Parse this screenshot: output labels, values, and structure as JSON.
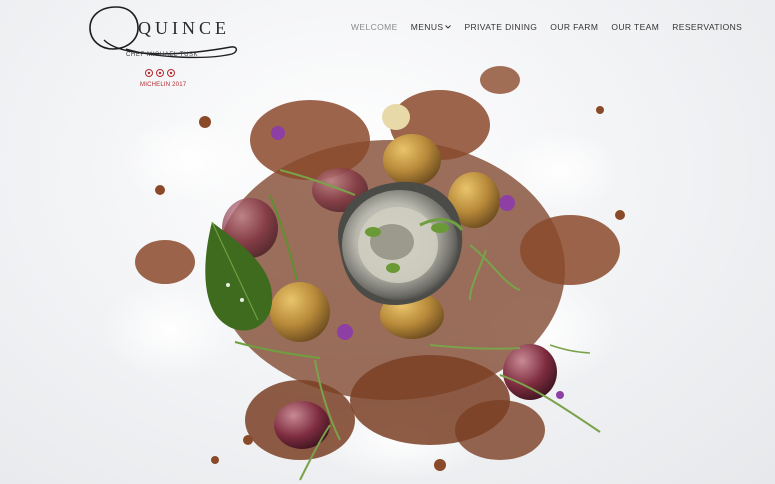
{
  "brand": {
    "name": "QUINCE",
    "chef": "CHEF MICHAEL TUSK",
    "award": "MICHELIN 2017",
    "award_color": "#b3292e"
  },
  "nav": {
    "items": [
      {
        "label": "WELCOME",
        "active": true
      },
      {
        "label": "MENUS",
        "has_dropdown": true
      },
      {
        "label": "PRIVATE DINING"
      },
      {
        "label": "OUR FARM"
      },
      {
        "label": "OUR TEAM"
      },
      {
        "label": "RESERVATIONS"
      }
    ]
  },
  "hero": {
    "subject": "plated oyster dish with crumble, potatoes, herbs and flowers on white foam"
  }
}
